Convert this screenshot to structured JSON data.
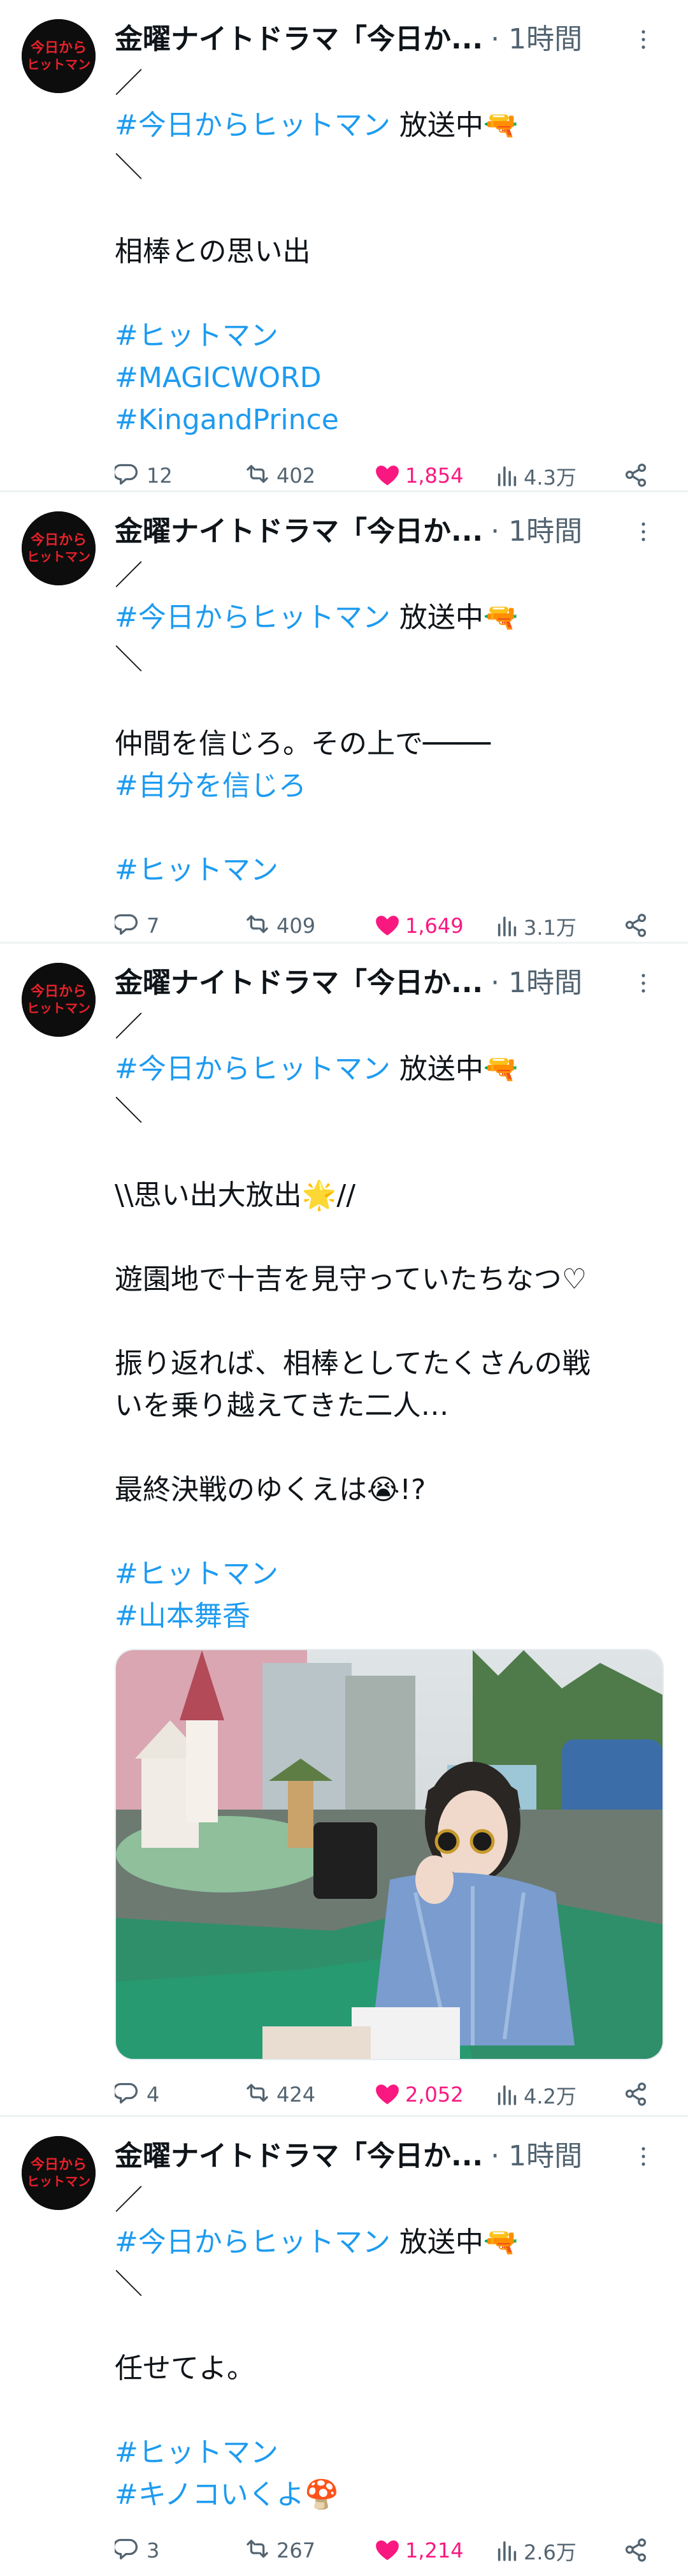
{
  "colors": {
    "link": "#1d9bf0",
    "like": "#f91880",
    "muted": "#536471",
    "text": "#0f1419"
  },
  "avatar_text": {
    "top": "今日から",
    "bottom": "ヒットマン"
  },
  "tweets": [
    {
      "author": "金曜ナイトドラマ「今日か",
      "ellipsis": "...",
      "time": "· 1時間",
      "lines": [
        "／",
        "#今日からヒットマン",
        "放送中🔫",
        "＼",
        "相棒との思い出",
        "#ヒットマン",
        "#MAGICWORD",
        "#KingandPrince"
      ],
      "replies": "12",
      "retweets": "402",
      "likes": "1,854",
      "views": "4.3万"
    },
    {
      "author": "金曜ナイトドラマ「今日か",
      "ellipsis": "...",
      "time": "· 1時間",
      "lines": [
        "／",
        "#今日からヒットマン",
        "放送中🔫",
        "＼",
        "仲間を信じろ。その上で────",
        "#自分を信じろ",
        "#ヒットマン"
      ],
      "replies": "7",
      "retweets": "409",
      "likes": "1,649",
      "views": "3.1万"
    },
    {
      "author": "金曜ナイトドラマ「今日か",
      "ellipsis": "...",
      "time": "· 1時間",
      "lines": [
        "／",
        "#今日からヒットマン",
        "放送中🔫",
        "＼",
        "\\\\思い出大放出🌟//",
        "遊園地で十吉を見守っていたちなつ♡",
        "振り返れば、相棒としてたくさんの戦",
        "いを乗り越えてきた二人…",
        "最終決戦のゆくえは😭!?",
        "#ヒットマン",
        "#山本舞香"
      ],
      "photo_sign": "200",
      "replies": "4",
      "retweets": "424",
      "likes": "2,052",
      "views": "4.2万"
    },
    {
      "author": "金曜ナイトドラマ「今日か",
      "ellipsis": "...",
      "time": "· 1時間",
      "lines": [
        "／",
        "#今日からヒットマン",
        "放送中🔫",
        "＼",
        "任せてよ。",
        "#ヒットマン",
        "#キノコいくよ🍄"
      ],
      "replies": "3",
      "retweets": "267",
      "likes": "1,214",
      "views": "2.6万"
    }
  ]
}
